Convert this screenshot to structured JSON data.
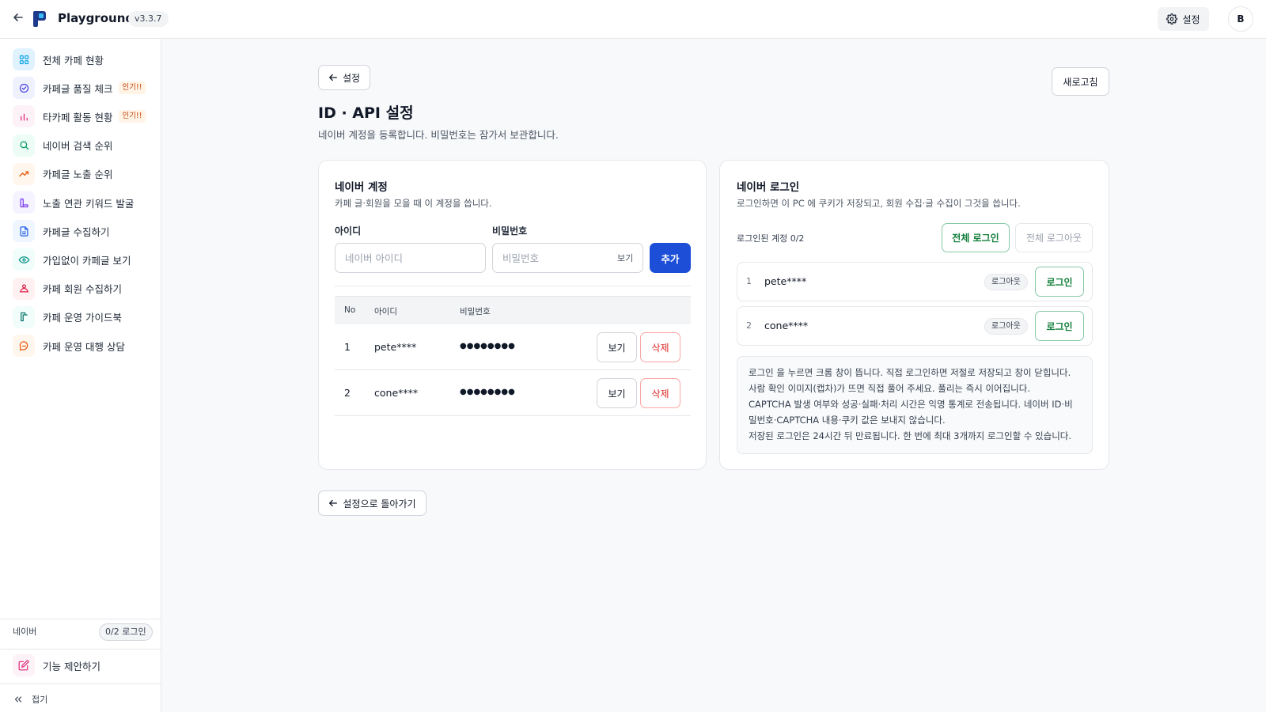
{
  "app": {
    "title": "Playground",
    "version": "v3.3.7"
  },
  "header": {
    "settings_label": "설정",
    "avatar_initial": "B"
  },
  "sidebar": {
    "items": [
      {
        "label": "전체 카페 현황",
        "icon": "grid-icon",
        "color": "#0ea5e9",
        "bg": "#e0f2fe"
      },
      {
        "label": "카페글 품질 체크",
        "icon": "check-circle-icon",
        "color": "#4f46e5",
        "bg": "#eef2ff",
        "badge": "인기!!"
      },
      {
        "label": "타카페 활동 현황",
        "icon": "bar-chart-icon",
        "color": "#db2777",
        "bg": "#fdf2f8",
        "badge": "인기!!"
      },
      {
        "label": "네이버 검색 순위",
        "icon": "search-icon",
        "color": "#059669",
        "bg": "#ecfdf5"
      },
      {
        "label": "카페글 노출 순위",
        "icon": "trending-up-icon",
        "color": "#ea580c",
        "bg": "#fff7ed"
      },
      {
        "label": "노출 연관 키워드 발굴",
        "icon": "chart-icon",
        "color": "#7c3aed",
        "bg": "#f5f3ff"
      },
      {
        "label": "카페글 수집하기",
        "icon": "document-icon",
        "color": "#2563eb",
        "bg": "#eff6ff"
      },
      {
        "label": "가입없이 카페글 보기",
        "icon": "eye-icon",
        "color": "#0d9488",
        "bg": "#f0fdfa"
      },
      {
        "label": "카페 회원 수집하기",
        "icon": "users-icon",
        "color": "#e11d48",
        "bg": "#fff1f2"
      },
      {
        "label": "카페 운영 가이드북",
        "icon": "book-icon",
        "color": "#0f766e",
        "bg": "#f0fdfa"
      },
      {
        "label": "카페 운영 대행 상담",
        "icon": "chat-icon",
        "color": "#ea580c",
        "bg": "#fff7ed"
      }
    ],
    "naver_label": "네이버",
    "naver_status": "0/2 로그인",
    "suggest_label": "기능 제안하기",
    "collapse_label": "접기"
  },
  "main": {
    "back_label": "설정",
    "refresh_label": "새로고침",
    "title": "ID · API 설정",
    "subtitle": "네이버 계정을 등록합니다. 비밀번호는 잠가서 보관합니다.",
    "footer_back_label": "설정으로 돌아가기"
  },
  "account_card": {
    "title": "네이버 계정",
    "subtitle": "카페 글·회원을 모을 때 이 계정을 씁니다.",
    "id_label": "아이디",
    "id_placeholder": "네이버 아이디",
    "pw_label": "비밀번호",
    "pw_placeholder": "비밀번호",
    "pw_toggle": "보기",
    "add_label": "추가",
    "columns": [
      "No",
      "아이디",
      "비밀번호"
    ],
    "rows": [
      {
        "no": "1",
        "id": "pete****",
        "pw": "●●●●●●●●",
        "view": "보기",
        "delete": "삭제"
      },
      {
        "no": "2",
        "id": "cone****",
        "pw": "●●●●●●●●",
        "view": "보기",
        "delete": "삭제"
      }
    ]
  },
  "login_card": {
    "title": "네이버 로그인",
    "subtitle": "로그인하면 이 PC 에 쿠키가 저장되고, 회원 수집·글 수집이 그것을 씁니다.",
    "logged_count": "로그인된 계정 0/2",
    "login_all": "전체 로그인",
    "logout_all": "전체 로그아웃",
    "accounts": [
      {
        "no": "1",
        "id": "pete****",
        "status": "로그아웃",
        "action": "로그인"
      },
      {
        "no": "2",
        "id": "cone****",
        "status": "로그아웃",
        "action": "로그인"
      }
    ],
    "notice": [
      "로그인 을 누르면 크롬 창이 뜹니다. 직접 로그인하면 저절로 저장되고 창이 닫힙니다.",
      "사람 확인 이미지(캡차)가 뜨면 직접 풀어 주세요. 풀리는 즉시 이어집니다.",
      "CAPTCHA 발생 여부와 성공·실패·처리 시간은 익명 통계로 전송됩니다. 네이버 ID·비",
      "밀번호·CAPTCHA 내용·쿠키 값은 보내지 않습니다.",
      "저장된 로그인은 24시간 뒤 만료됩니다. 한 번에 최대 3개까지 로그인할 수 있습니다."
    ]
  },
  "colors": {
    "primary": "#1d4ed8",
    "danger": "#dc2626",
    "success": "#15803d",
    "badge": "#c2410c"
  }
}
